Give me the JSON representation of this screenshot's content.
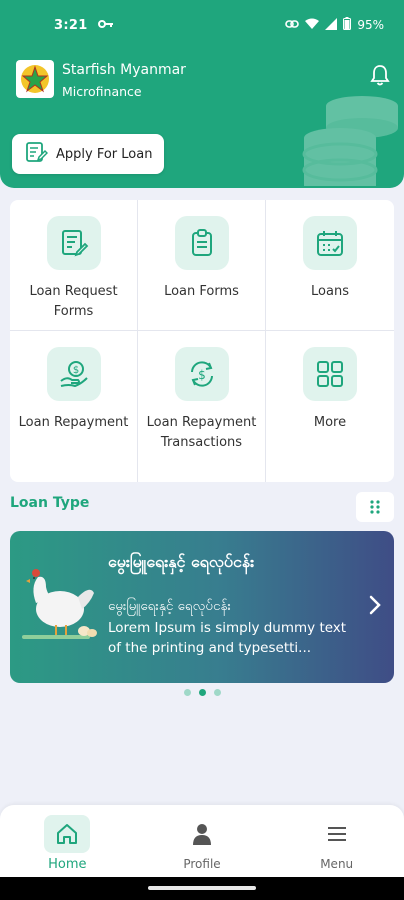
{
  "status_bar": {
    "time": "3:21",
    "battery": "95%"
  },
  "header": {
    "brand_name": "Starfish Myanmar",
    "brand_sub": "Microfinance",
    "apply_label": "Apply For Loan"
  },
  "menu": {
    "items": [
      {
        "label": "Loan Request Forms",
        "icon": "form-edit-icon"
      },
      {
        "label": "Loan Forms",
        "icon": "clipboard-icon"
      },
      {
        "label": "Loans",
        "icon": "calendar-icon"
      },
      {
        "label": "Loan Repayment",
        "icon": "hand-coin-icon"
      },
      {
        "label": "Loan Repayment Transactions",
        "icon": "refresh-dollar-icon"
      },
      {
        "label": "More",
        "icon": "grid-icon"
      }
    ]
  },
  "loan_type": {
    "title": "Loan Type",
    "banner": {
      "title": "မွေးမြူရေးနှင့် ရေလုပ်ငန်း",
      "subtitle": "မွေးမြူရေးနှင့် ရေလုပ်ငန်း",
      "description": "Lorem Ipsum is simply dummy text of the printing and typesetti..."
    },
    "pager": {
      "count": 3,
      "active": 2
    }
  },
  "bottom_nav": {
    "items": [
      {
        "label": "Home",
        "icon": "home-icon",
        "active": true
      },
      {
        "label": "Profile",
        "icon": "person-icon",
        "active": false
      },
      {
        "label": "Menu",
        "icon": "hamburger-icon",
        "active": false
      }
    ]
  },
  "colors": {
    "primary": "#1fa67d",
    "icon_bg": "#e0f3ed",
    "background": "#eef0f8"
  }
}
